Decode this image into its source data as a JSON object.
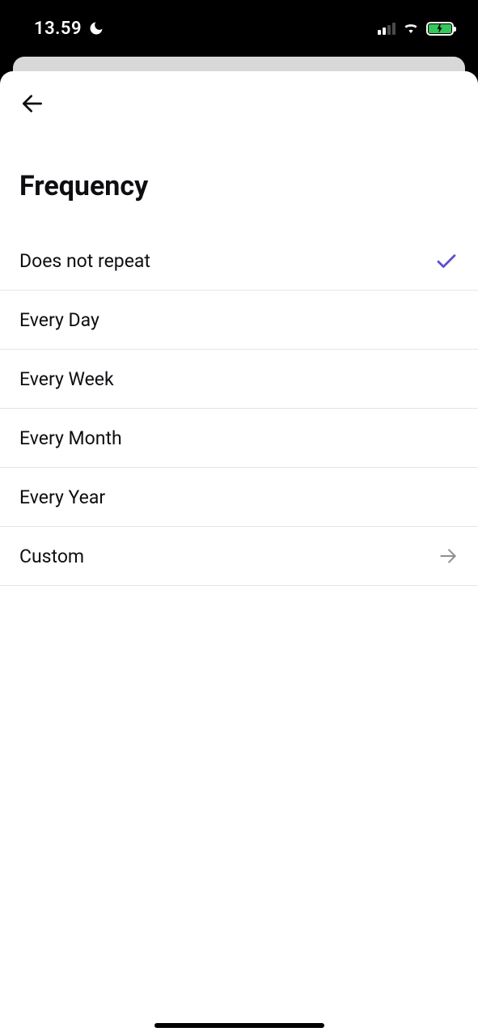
{
  "status": {
    "time": "13.59"
  },
  "page": {
    "title": "Frequency"
  },
  "options": [
    {
      "label": "Does not repeat",
      "selected": true,
      "navigates": false
    },
    {
      "label": "Every Day",
      "selected": false,
      "navigates": false
    },
    {
      "label": "Every Week",
      "selected": false,
      "navigates": false
    },
    {
      "label": "Every Month",
      "selected": false,
      "navigates": false
    },
    {
      "label": "Every Year",
      "selected": false,
      "navigates": false
    },
    {
      "label": "Custom",
      "selected": false,
      "navigates": true
    }
  ],
  "colors": {
    "accent": "#5b4fc8",
    "divider": "#e5e5ea",
    "battery": "#34c759"
  }
}
